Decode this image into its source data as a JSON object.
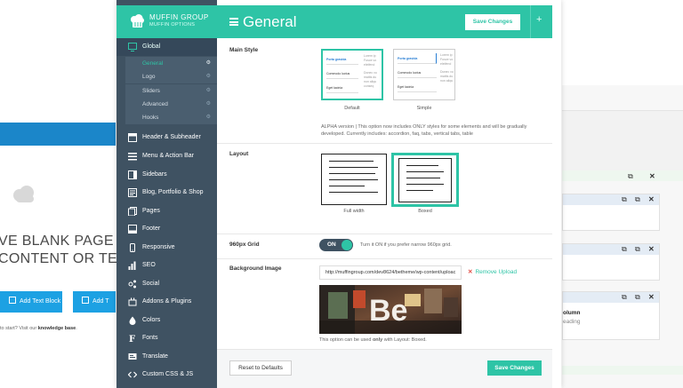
{
  "background_left": {
    "headline_line1": "VE BLANK PAGE",
    "headline_line2": "CONTENT OR TEM",
    "add_text_block": "Add Text Block",
    "add_t": "Add T",
    "help_text_prefix": "to start? Visit our ",
    "help_link": "knowledge base",
    "help_suffix": "."
  },
  "background_right": {
    "column_title": "olumn",
    "column_sub": "eading"
  },
  "brand": {
    "title": "MUFFIN GROUP",
    "subtitle": "MUFFIN OPTIONS",
    "accent": "#2ec4a6",
    "sidebar_bg": "#3f5262"
  },
  "sidebar": {
    "global": {
      "label": "Global",
      "icon": "window-icon",
      "children": [
        {
          "label": "General"
        },
        {
          "label": "Logo"
        },
        {
          "label": "Sliders"
        },
        {
          "label": "Advanced"
        },
        {
          "label": "Hooks"
        }
      ]
    },
    "items": [
      {
        "label": "Header & Subheader",
        "icon": "header-icon"
      },
      {
        "label": "Menu & Action Bar",
        "icon": "menu-icon"
      },
      {
        "label": "Sidebars",
        "icon": "sidebar-icon"
      },
      {
        "label": "Blog, Portfolio & Shop",
        "icon": "blog-icon"
      },
      {
        "label": "Pages",
        "icon": "pages-icon"
      },
      {
        "label": "Footer",
        "icon": "footer-icon"
      },
      {
        "label": "Responsive",
        "icon": "responsive-icon"
      },
      {
        "label": "SEO",
        "icon": "chart-icon"
      },
      {
        "label": "Social",
        "icon": "social-icon"
      },
      {
        "label": "Addons & Plugins",
        "icon": "plugin-icon"
      },
      {
        "label": "Colors",
        "icon": "palette-icon"
      },
      {
        "label": "Fonts",
        "icon": "font-icon"
      },
      {
        "label": "Translate",
        "icon": "translate-icon"
      },
      {
        "label": "Custom CSS & JS",
        "icon": "code-icon"
      }
    ]
  },
  "header": {
    "title": "General",
    "save_label": "Save Changes",
    "plus": "+"
  },
  "main_style": {
    "label": "Main Style",
    "options": [
      {
        "caption": "Default",
        "selected": true
      },
      {
        "caption": "Simple",
        "selected": false
      }
    ],
    "mini_items": [
      "Porta gravida",
      "Commodo luctus",
      "Eget lacinia"
    ],
    "mini_text": [
      "Lorem ip",
      "Fusce vo",
      "eleifend",
      "Donec vo",
      "mattis du",
      "non aliqu",
      "conseq"
    ],
    "note_line1": "ALPHA version | This option now includes ONLY styles for some elements and will be gradually",
    "note_line2": "developed. Currently includes: accordion, faq, tabs, vertical tabs, table"
  },
  "layout": {
    "label": "Layout",
    "options": [
      {
        "caption": "Full width",
        "selected": false
      },
      {
        "caption": "Boxed",
        "selected": true
      }
    ]
  },
  "grid": {
    "label": "960px Grid",
    "toggle_value": "ON",
    "help": "Turn it ON if you prefer narrow 960px grid."
  },
  "background_image": {
    "label": "Background Image",
    "url": "http://muffingroup.com/dev8624/betheme/wp-content/uploac",
    "remove_label": "Remove Upload",
    "preview_text": "Be",
    "note_prefix": "This option can be used ",
    "note_bold": "only",
    "note_suffix": " with Layout: Boxed."
  },
  "footer": {
    "reset_label": "Reset to Defaults",
    "save_label": "Save Changes"
  }
}
